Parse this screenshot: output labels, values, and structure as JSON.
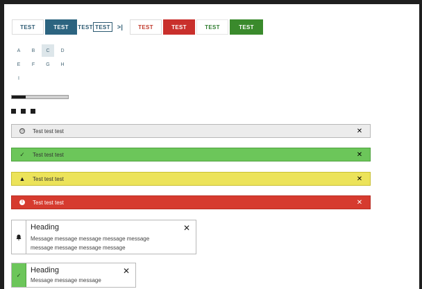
{
  "buttons": {
    "outline_dark": "TEST",
    "solid_dark": "TEST",
    "text_plain": "TEST",
    "text_boxed": "TEST",
    "icon_button": ">|",
    "outline_red": "TEST",
    "solid_red": "TEST",
    "outline_green": "TEST",
    "solid_green": "TEST"
  },
  "grid": {
    "letters": [
      "A",
      "B",
      "C",
      "D",
      "E",
      "F",
      "G",
      "H",
      "I"
    ],
    "selected": "C"
  },
  "progress": {
    "value": 0.25
  },
  "banners": {
    "info": {
      "text": "Test test test",
      "close": "✕",
      "icon": "clock-icon"
    },
    "success": {
      "text": "Test test test",
      "close": "✕",
      "icon": "checkmark-icon"
    },
    "warning": {
      "text": "Test test test",
      "close": "✕",
      "icon": "warning-triangle-icon"
    },
    "danger": {
      "text": "Test test test",
      "close": "✕",
      "icon": "alert-circle-icon"
    }
  },
  "toasts": {
    "first": {
      "heading": "Heading",
      "line1": "Message message message message message",
      "line2": "message message message message",
      "close": "✕",
      "icon": "bell-icon"
    },
    "second": {
      "heading": "Heading",
      "message": "Message message message",
      "close": "✕",
      "icon": "checkmark-icon"
    }
  },
  "colors": {
    "primary": "#2c6480",
    "danger": "#c9302c",
    "success": "#3a8a2c",
    "success_light": "#6cc65a",
    "warning": "#ece35a",
    "info": "#ececec"
  }
}
